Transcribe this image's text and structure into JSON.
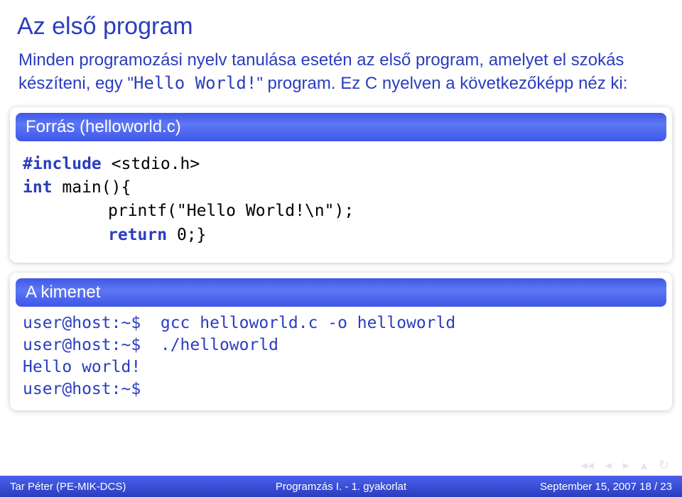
{
  "title": "Az első program",
  "para": "Minden programozási nyelv tanulása esetén az első program, amelyet el szokás készíteni, egy \"Hello World!\" program. Ez C nyelven a következőképp néz ki:",
  "block1": {
    "title": "Forrás (helloworld.c)",
    "code": {
      "l1a": "#include",
      "l1b": " <stdio.h>",
      "l2a": "int",
      "l2b": " main(){",
      "l3": "printf(\"Hello World!\\n\");",
      "l4a": "return",
      "l4b": " 0;}"
    }
  },
  "block2": {
    "title": "A kimenet",
    "out": "user@host:~$  gcc helloworld.c -o helloworld\nuser@host:~$  ./helloworld\nHello world!\nuser@host:~$"
  },
  "footer": {
    "left": "Tar Péter  (PE-MIK-DCS)",
    "center": "Programzás I. - 1. gyakorlat",
    "right": "September 15, 2007     18 / 23"
  }
}
